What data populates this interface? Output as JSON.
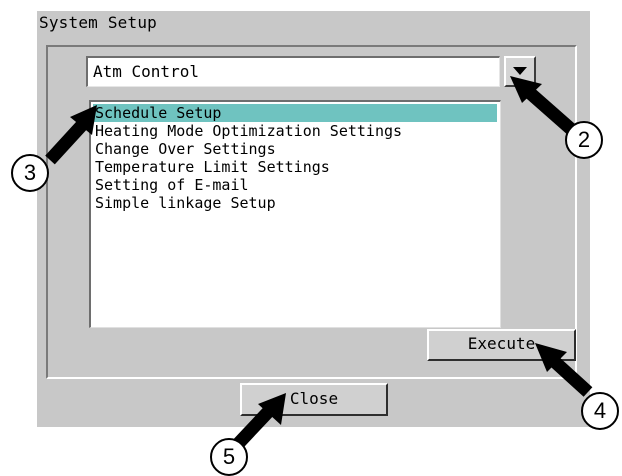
{
  "dialog": {
    "title": "System Setup",
    "combo": {
      "value": "Atm Control"
    },
    "list": {
      "items": [
        "Schedule Setup",
        "Heating Mode Optimization Settings",
        "Change Over Settings",
        "Temperature Limit Settings",
        "Setting of E-mail",
        "Simple linkage Setup"
      ],
      "selected_index": 0,
      "selected_color": "#6fc3c0"
    },
    "execute_label": "Execute",
    "close_label": "Close"
  },
  "callouts": {
    "c2": "2",
    "c3": "3",
    "c4": "4",
    "c5": "5"
  },
  "icons": [
    "chevron-down-icon",
    "callout-arrow-icon"
  ]
}
